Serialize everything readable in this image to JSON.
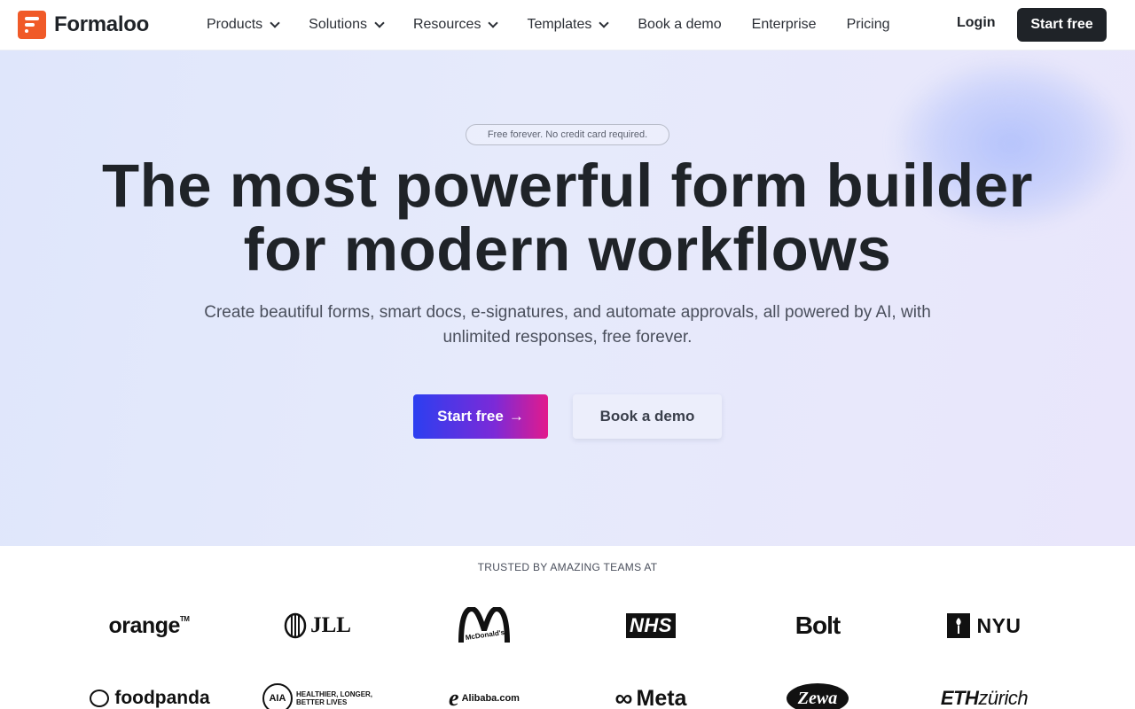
{
  "brand": {
    "name": "Formaloo",
    "accent": "#f05a28"
  },
  "nav": {
    "items": [
      {
        "label": "Products",
        "has_dropdown": true
      },
      {
        "label": "Solutions",
        "has_dropdown": true
      },
      {
        "label": "Resources",
        "has_dropdown": true
      },
      {
        "label": "Templates",
        "has_dropdown": true
      },
      {
        "label": "Book a demo",
        "has_dropdown": false
      },
      {
        "label": "Enterprise",
        "has_dropdown": false
      },
      {
        "label": "Pricing",
        "has_dropdown": false
      }
    ],
    "login_label": "Login",
    "start_label": "Start free"
  },
  "hero": {
    "badge": "Free forever. No credit card required.",
    "headline_line1": "The most powerful form builder",
    "headline_line2": "for modern workflows",
    "subtitle": "Create beautiful forms, smart docs, e-signatures, and automate approvals, all powered by AI, with unlimited responses, free forever.",
    "primary_cta": "Start free",
    "primary_cta_icon": "arrow-right-icon",
    "secondary_cta": "Book a demo",
    "gradient_colors": [
      "#2c3ff0",
      "#7b2ad8",
      "#e21a8c"
    ]
  },
  "trusted": {
    "heading": "TRUSTED BY AMAZING TEAMS AT",
    "logos_row1": [
      "orange",
      "JLL",
      "McDonald's",
      "NHS",
      "Bolt",
      "NYU"
    ],
    "logos_row2": [
      "foodpanda",
      "AIA",
      "Alibaba.com",
      "Meta",
      "Zewa",
      "ETH zürich"
    ],
    "logo_texts": {
      "orange": "orange",
      "orange_tm": "TM",
      "jll": "JLL",
      "mcd": "McDonald's",
      "nhs": "NHS",
      "bolt": "Bolt",
      "nyu": "NYU",
      "foodpanda": "foodpanda",
      "aia": "AIA",
      "aia_tag_1": "HEALTHIER, LONGER,",
      "aia_tag_2": "BETTER LIVES",
      "alibaba_mark": "e",
      "alibaba": "Alibaba.com",
      "meta": "Meta",
      "zewa": "Zewa",
      "eth": "ETH",
      "zurich": "zürich"
    }
  }
}
